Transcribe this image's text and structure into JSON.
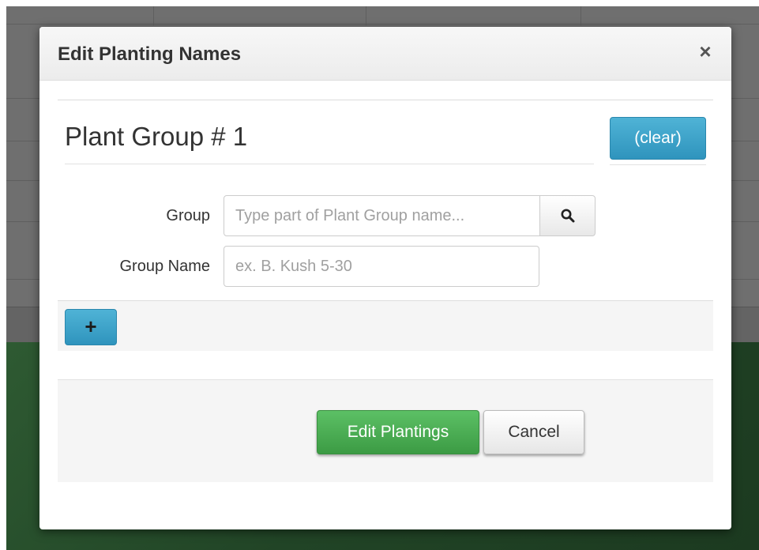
{
  "modal": {
    "title": "Edit Planting Names",
    "close_glyph": "×"
  },
  "group": {
    "heading": "Plant Group # 1",
    "clear_label": "(clear)",
    "group_label": "Group",
    "group_placeholder": "Type part of Plant Group name...",
    "group_value": "",
    "search_icon": "search-icon",
    "name_label": "Group Name",
    "name_placeholder": "ex. B. Kush 5-30",
    "name_value": "",
    "add_label": "+"
  },
  "footer": {
    "primary_label": "Edit Plantings",
    "cancel_label": "Cancel"
  },
  "colors": {
    "info_button": "#3aa3cb",
    "success_button": "#4cae4c",
    "background_green": "#214426"
  }
}
